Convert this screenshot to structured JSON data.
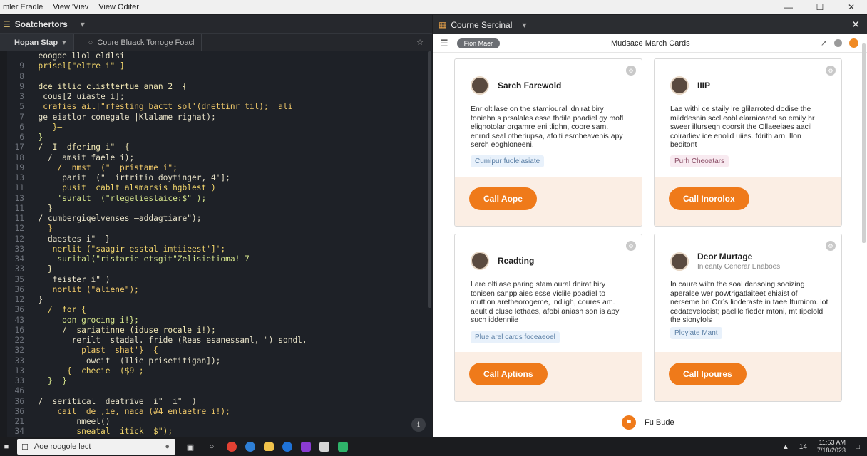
{
  "titlebar": {
    "menu": [
      "mler Eradle",
      "View 'Viev",
      "View Oditer"
    ]
  },
  "editor": {
    "panel_title": "Soatchertors",
    "tabs": [
      {
        "label": "Hopan Stap"
      },
      {
        "label": "Coure Bluack Torroge Foacl"
      }
    ],
    "lines": [
      {
        "n": "",
        "t": "  eoogde llol eldlsi"
      },
      {
        "n": "9",
        "t": "  prisel[\"eltre i\" ]"
      },
      {
        "n": "8",
        "t": ""
      },
      {
        "n": "9",
        "t": "  dce itlic clisttertue anan 2  {"
      },
      {
        "n": "3",
        "t": "   cous[2 uiaste i];"
      },
      {
        "n": "5",
        "t": "   crafies ail|\"rfesting bactt sol'(dnettinr til);  ali"
      },
      {
        "n": "7",
        "t": "  ge eiatlor conegale |Klalame righat);"
      },
      {
        "n": "6",
        "t": "     }—"
      },
      {
        "n": "6",
        "t": "  }"
      },
      {
        "n": "17",
        "t": "  /  I  dfering i\"  {"
      },
      {
        "n": "18",
        "t": "    /  amsit faele i);"
      },
      {
        "n": "19",
        "t": "      /  nmst  (\"  pristame i\";"
      },
      {
        "n": "13",
        "t": "       parit  (\"  irtritio doytinger, 4'];"
      },
      {
        "n": "11",
        "t": "       pusit  cablt alsmarsis hgblest )"
      },
      {
        "n": "13",
        "t": "      'suralt  (\"rlegelieslaice:$\" );"
      },
      {
        "n": "11",
        "t": "    }"
      },
      {
        "n": "11",
        "t": "  / cumbergiqelvenses —addagtiare\");"
      },
      {
        "n": "12",
        "t": "    }"
      },
      {
        "n": "12",
        "t": "    daestes i\"  }"
      },
      {
        "n": "33",
        "t": "     nerlit (\"saagir esstal imtiieest']';"
      },
      {
        "n": "34",
        "t": "      surital(\"ristarie etsgit\"Zelisietioma! 7"
      },
      {
        "n": "33",
        "t": "    }"
      },
      {
        "n": "35",
        "t": "     feister i\" )"
      },
      {
        "n": "36",
        "t": "     norlit (\"aliene\");"
      },
      {
        "n": "12",
        "t": "  }"
      },
      {
        "n": "36",
        "t": "    /  for {"
      },
      {
        "n": "43",
        "t": "       oon grocing i!};"
      },
      {
        "n": "16",
        "t": "       /  sariatinne (iduse rocale i!);"
      },
      {
        "n": "22",
        "t": "         rerilt  stadal. fride (Reas esanessanl, \") sondl,"
      },
      {
        "n": "32",
        "t": "           plast  shat'}  {"
      },
      {
        "n": "33",
        "t": "            owcit  (Ilie prisetitigan]);"
      },
      {
        "n": "13",
        "t": "        {  checie  ($9 ;"
      },
      {
        "n": "33",
        "t": "    }  }"
      },
      {
        "n": "46",
        "t": ""
      },
      {
        "n": "36",
        "t": "  /  seritical  deatrive  i\"  i\"  )"
      },
      {
        "n": "36",
        "t": "      cail  de ,ie, naca (#4 enlaetre i!);"
      },
      {
        "n": "21",
        "t": "          nmeel()"
      },
      {
        "n": "34",
        "t": "          sneatal  itick  $\");"
      }
    ]
  },
  "panel": {
    "title": "Courne Sercinal",
    "pill": "Fion Maer",
    "center_title": "Mudsace March Cards",
    "cards": [
      {
        "name": "Sarch Farewold",
        "sub": "",
        "body": "Enr oltilase on the stamiourall dnirat biry toniehn s prsalales esse thdile poadiel gy mofl elignotolar orgamre eni tlighn, coore sam. enrnd seal otheriupsa, afolti esmheavenis apy serch eoghloneeni.",
        "tag": "Cumipur fuolelasiate",
        "tag_style": "blue",
        "cta": "Call Aope"
      },
      {
        "name": "IIIP",
        "sub": "",
        "body": "Lae withi ce staily lre glilarroted dodise the milddesnin sccl eobl elarnicared so emily hr sweer illurseqh coorsit the Ollaeeiaes aacil coirarliev ice enolid uiies. fdrith arn. Ilon beditont",
        "tag": "Purh Cheoatars",
        "tag_style": "pink",
        "cta": "Call Inorolox"
      },
      {
        "name": "Readting",
        "sub": "",
        "body": "Lare oltilase paring stamioural dnirat biry tonisen sanpplaies esse viclile poadiel to muttion aretheorogeme, indligh, coures am. aeult d cluse lethaes, afobi aniash son is apy such iddenniie",
        "tag": "Plue arel cards foceaeoel",
        "tag_style": "blue",
        "cta": "Call Aptions"
      },
      {
        "name": "Deor Murtage",
        "sub": "Inleanty Cenerar Enaboes",
        "body": "In caure wiltn the soal densoing sooizing aperalse wer powtrigatlaiteet ehiaist of nerseme bri Orr’s lioderaste in taee Itumiom. lot cedatevelocist; paelile fieder mtoni, mt Iipelold the sionyfols",
        "tag": "Ploylate Mant",
        "tag_style": "blue",
        "cta": "Call Ipoures"
      }
    ],
    "footer": "Fu Bude"
  },
  "taskbar": {
    "search_placeholder": "Aoe roogole lect",
    "clock_time": "11:53 AM",
    "clock_date": "7/18/2023",
    "tray_text": "14"
  }
}
